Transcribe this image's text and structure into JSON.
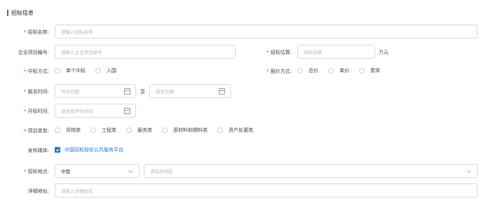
{
  "section": {
    "title": "招标信息"
  },
  "fields": {
    "bid_name": {
      "label": "招标名称:",
      "placeholder": "请输入招标名称"
    },
    "enterprise_no": {
      "label": "企业项目编号:",
      "placeholder": "请输入企业项目编号"
    },
    "bid_estimate": {
      "label": "招标估算:",
      "placeholder": "招标估算",
      "unit": "万元"
    },
    "win_method": {
      "label": "中标方式:",
      "options": [
        "单个中标",
        "入围"
      ]
    },
    "quote_method": {
      "label": "报价方式:",
      "options": [
        "总价",
        "单价",
        "费率"
      ]
    },
    "signup_time": {
      "label": "报名时间:",
      "start_placeholder": "开始日期",
      "separator": "至",
      "end_placeholder": "结束日期"
    },
    "open_time": {
      "label": "开标时间:",
      "placeholder": "请选择开标时间"
    },
    "project_type": {
      "label": "项目类型:",
      "options": [
        "货物类",
        "工程类",
        "服务类",
        "原材料和燃料类",
        "资产处置类"
      ]
    },
    "publish_media": {
      "label": "发布媒体:",
      "option": "中国招标投标公共服务平台"
    },
    "bid_location": {
      "label": "招标地点:",
      "country": "中国",
      "region_placeholder": "请选择地区"
    },
    "address": {
      "label": "详细地址:",
      "placeholder": "请输入详细地址"
    }
  },
  "colors": {
    "accent": "#1a73d9",
    "required": "#e33333"
  }
}
